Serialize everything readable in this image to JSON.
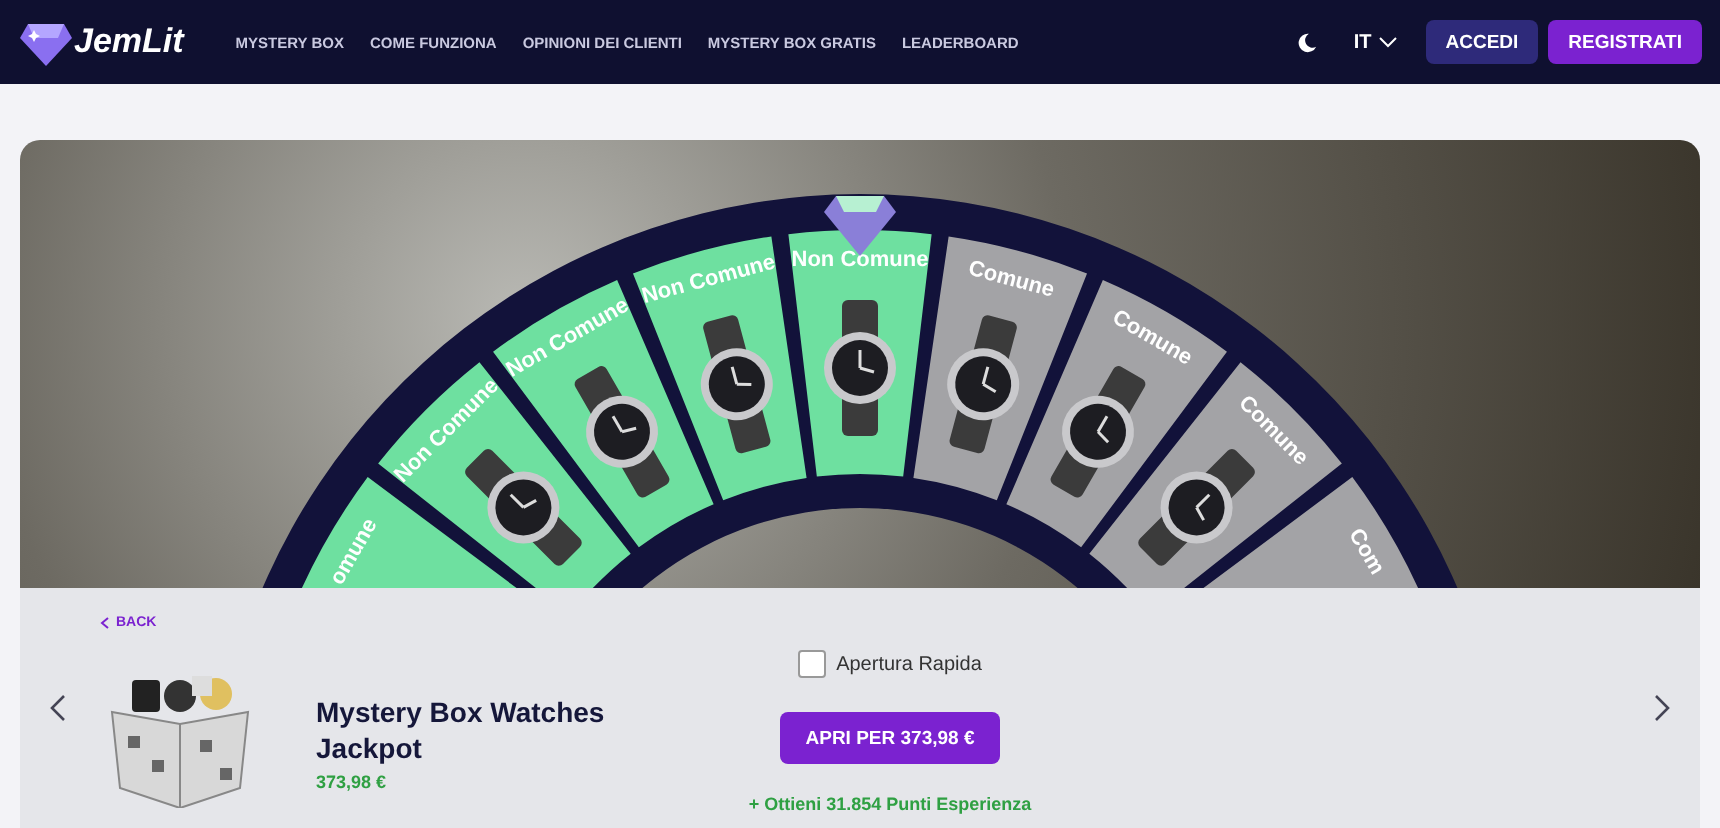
{
  "header": {
    "logo": "JemLit",
    "nav": [
      "MYSTERY BOX",
      "COME FUNZIONA",
      "OPINIONI DEI CLIENTI",
      "MYSTERY BOX GRATIS",
      "LEADERBOARD"
    ],
    "language": "IT",
    "login": "ACCEDI",
    "register": "REGISTRATI"
  },
  "wheel": {
    "segments": [
      {
        "label": "omune",
        "kind": "uncommon"
      },
      {
        "label": "Non Comune",
        "kind": "uncommon"
      },
      {
        "label": "Non Comune",
        "kind": "uncommon"
      },
      {
        "label": "Non Comune",
        "kind": "uncommon"
      },
      {
        "label": "Non Comune",
        "kind": "uncommon"
      },
      {
        "label": "Comune",
        "kind": "common"
      },
      {
        "label": "Comune",
        "kind": "common"
      },
      {
        "label": "Comune",
        "kind": "common"
      },
      {
        "label": "Com",
        "kind": "common"
      }
    ]
  },
  "product": {
    "back": "BACK",
    "title": "Mystery Box Watches Jackpot",
    "price": "373,98 €",
    "quick_open": {
      "label": "Apertura Rapida",
      "checked": false
    },
    "open_button": "APRI PER 373,98 €",
    "xp": "+ Ottieni 31.854 Punti Esperienza"
  }
}
